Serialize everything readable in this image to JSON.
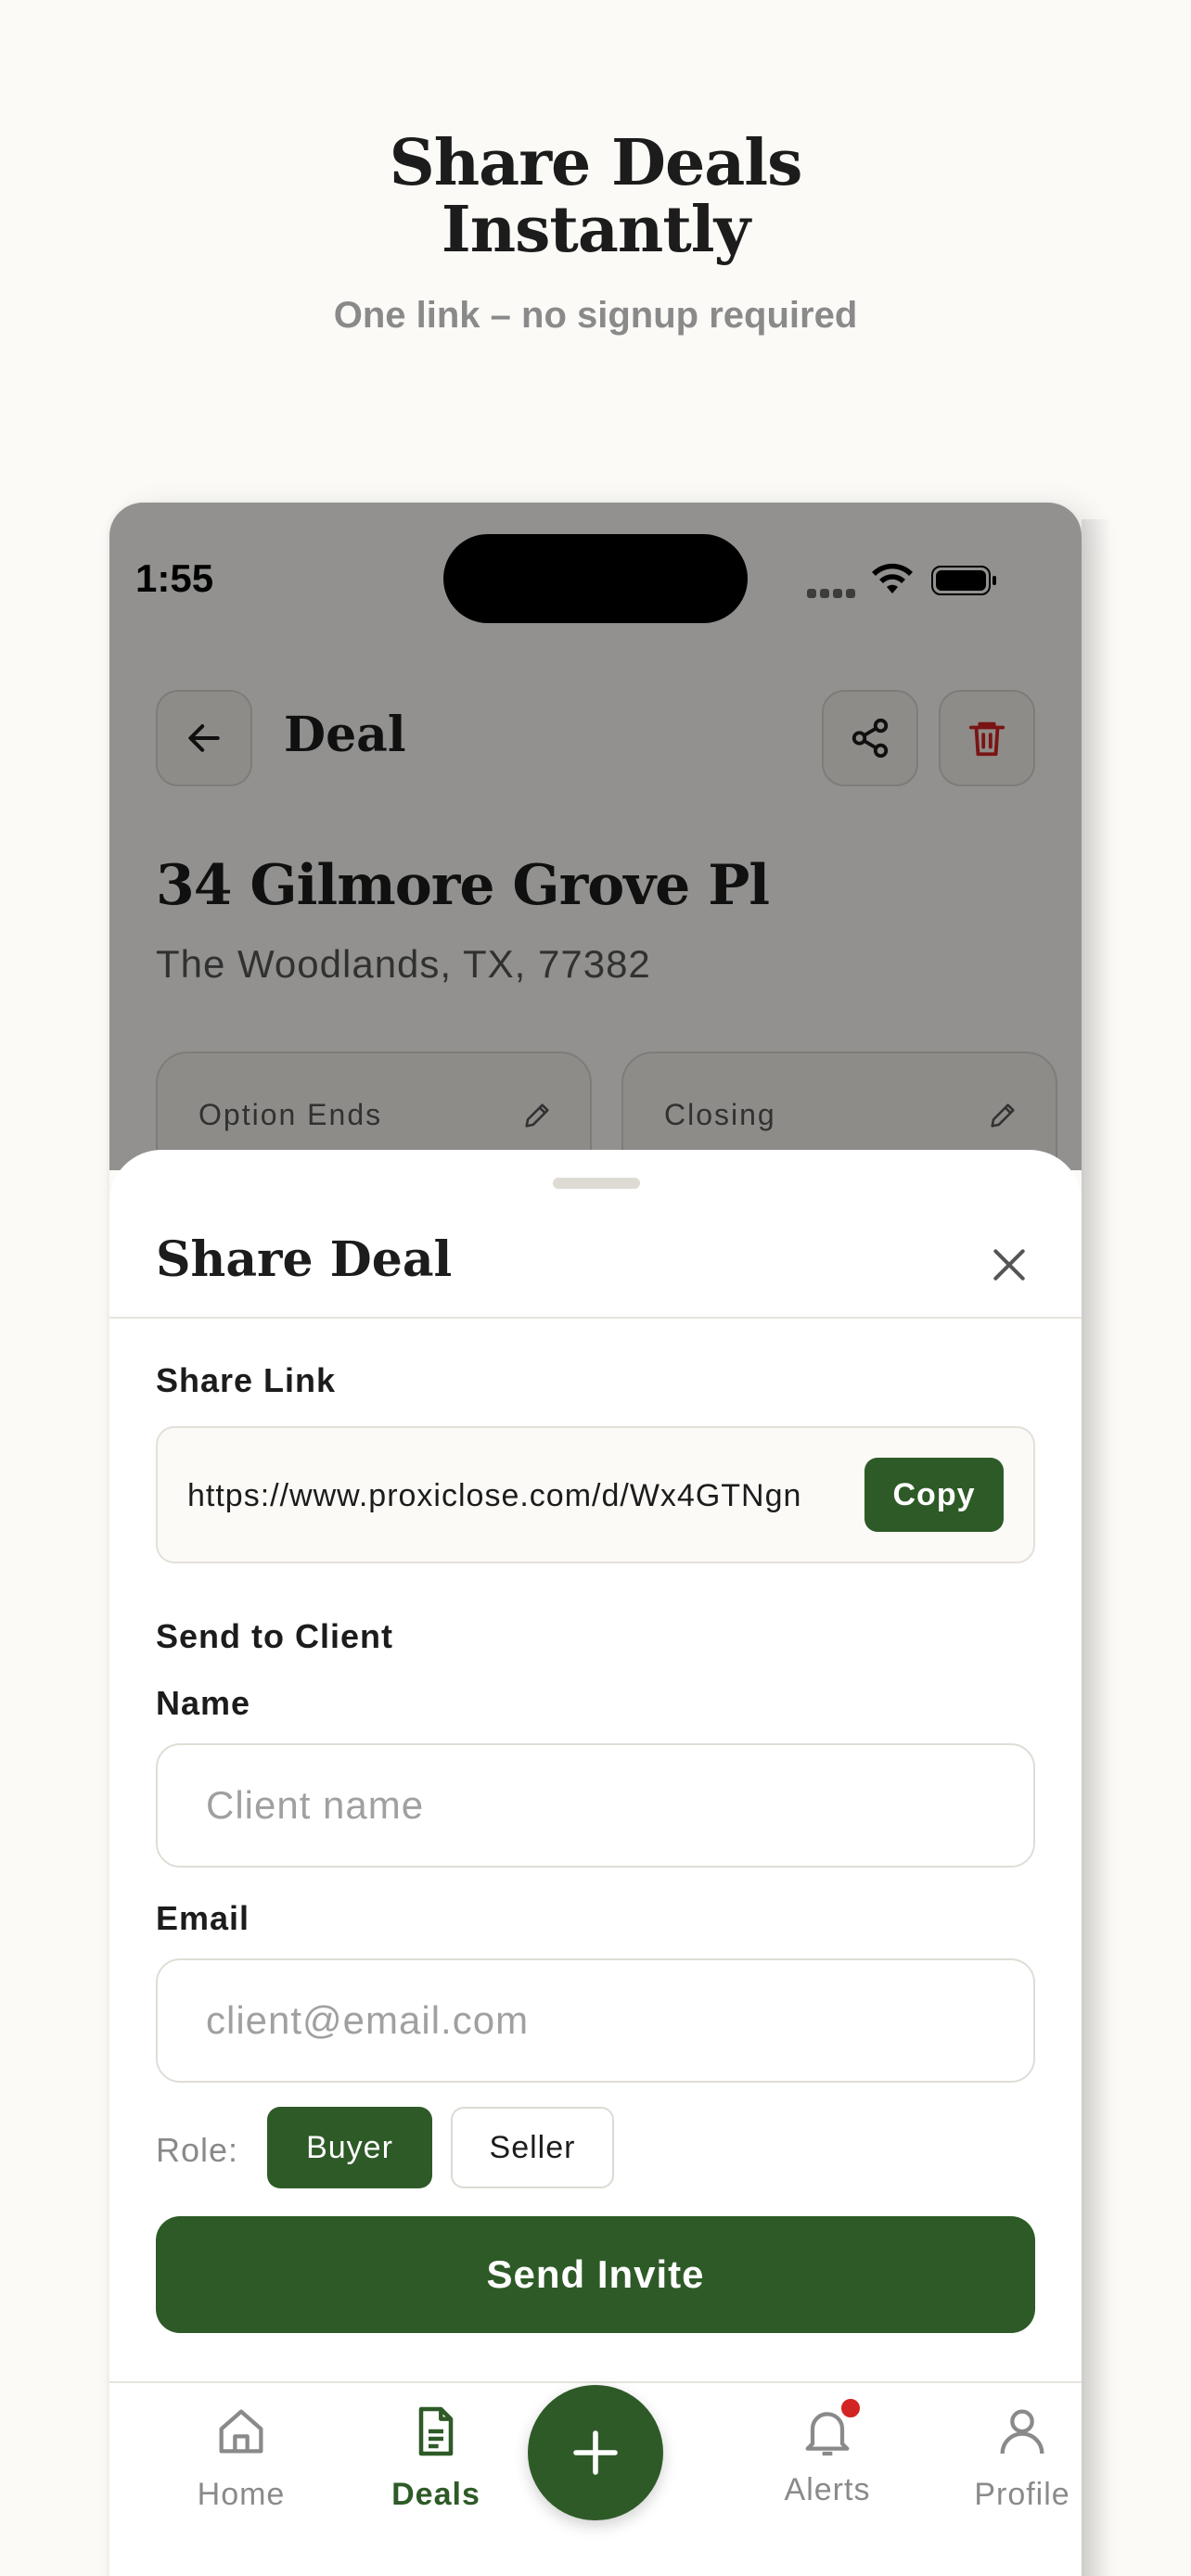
{
  "hero": {
    "title_line1": "Share Deals",
    "title_line2": "Instantly",
    "subtitle": "One link – no signup required"
  },
  "status_bar": {
    "time": "1:55"
  },
  "header": {
    "title": "Deal"
  },
  "deal": {
    "address": "34 Gilmore Grove Pl",
    "city": "The Woodlands, TX, 77382",
    "cards": [
      {
        "label": "Option Ends"
      },
      {
        "label": "Closing"
      }
    ]
  },
  "share_sheet": {
    "title": "Share Deal",
    "share_link_label": "Share Link",
    "link": "https://www.proxiclose.com/d/Wx4GTNgn",
    "copy_label": "Copy",
    "send_section_label": "Send to Client",
    "name_label": "Name",
    "name_placeholder": "Client name",
    "email_label": "Email",
    "email_placeholder": "client@email.com",
    "role_label": "Role:",
    "roles": [
      {
        "label": "Buyer",
        "selected": true
      },
      {
        "label": "Seller",
        "selected": false
      }
    ],
    "send_button": "Send Invite"
  },
  "tab_bar": {
    "items": [
      {
        "label": "Home",
        "icon": "home-icon",
        "active": false
      },
      {
        "label": "Deals",
        "icon": "document-icon",
        "active": true
      },
      {
        "label": "Alerts",
        "icon": "bell-icon",
        "active": false,
        "badge": true
      },
      {
        "label": "Profile",
        "icon": "person-icon",
        "active": false
      }
    ],
    "fab_icon": "plus-icon"
  },
  "colors": {
    "brand_green": "#2E5A27",
    "background": "#FBFAF7",
    "danger_red": "#D32424",
    "muted_text": "#8A8A8A"
  }
}
